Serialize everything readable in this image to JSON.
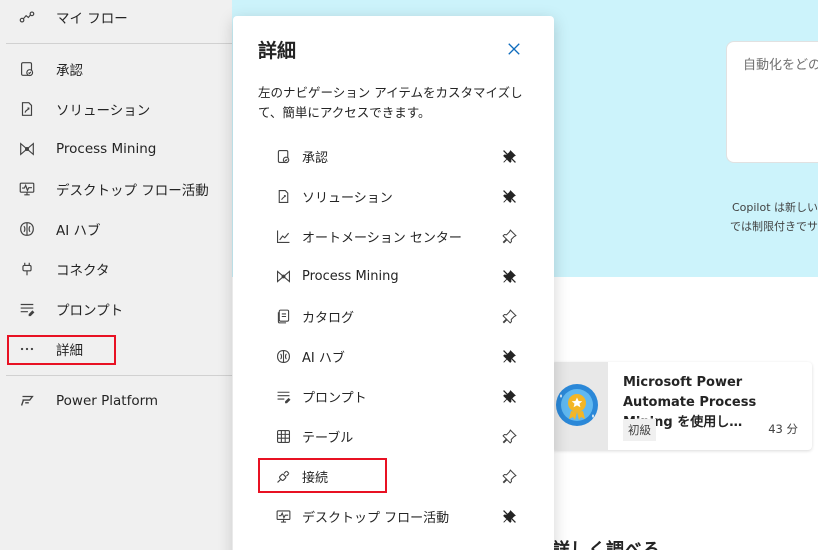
{
  "sidebar": {
    "items": [
      {
        "label": "マイ フロー",
        "icon": "flow-icon"
      },
      {
        "label": "承認",
        "icon": "approval-icon"
      },
      {
        "label": "ソリューション",
        "icon": "solution-icon"
      },
      {
        "label": "Process Mining",
        "icon": "process-mining-icon"
      },
      {
        "label": "デスクトップ フロー活動",
        "icon": "desktop-flow-icon"
      },
      {
        "label": "AI ハブ",
        "icon": "ai-hub-icon"
      },
      {
        "label": "コネクタ",
        "icon": "connector-icon"
      },
      {
        "label": "プロンプト",
        "icon": "prompt-icon"
      },
      {
        "label": "詳細",
        "icon": "more-icon"
      },
      {
        "label": "Power Platform",
        "icon": "power-platform-icon"
      }
    ]
  },
  "panel": {
    "title": "詳細",
    "description": "左のナビゲーション アイテムをカスタマイズして、簡単にアクセスできます。",
    "items": [
      {
        "label": "承認",
        "icon": "approval-icon",
        "pinned": true
      },
      {
        "label": "ソリューション",
        "icon": "solution-icon",
        "pinned": true
      },
      {
        "label": "オートメーション センター",
        "icon": "chart-icon",
        "pinned": false
      },
      {
        "label": "Process Mining",
        "icon": "process-mining-icon",
        "pinned": true
      },
      {
        "label": "カタログ",
        "icon": "catalog-icon",
        "pinned": false
      },
      {
        "label": "AI ハブ",
        "icon": "ai-hub-icon",
        "pinned": true
      },
      {
        "label": "プロンプト",
        "icon": "prompt-icon",
        "pinned": true
      },
      {
        "label": "テーブル",
        "icon": "table-icon",
        "pinned": false
      },
      {
        "label": "接続",
        "icon": "connection-icon",
        "pinned": false
      },
      {
        "label": "デスクトップ フロー活動",
        "icon": "desktop-flow-icon",
        "pinned": true
      }
    ]
  },
  "main": {
    "prompt_placeholder": "自動化をどの",
    "copilot_note_line1": "Copilot は新しい",
    "copilot_note_line2": "では制限付きでサ",
    "card": {
      "title": "Microsoft Power Automate Process Mining を使用し…",
      "badge": "初級",
      "duration": "43 分"
    },
    "section_heading": "詳しく調べる"
  },
  "colors": {
    "accent": "#0f6cbd",
    "highlight": "#e81123",
    "hero_background": "#ccf3fb"
  }
}
